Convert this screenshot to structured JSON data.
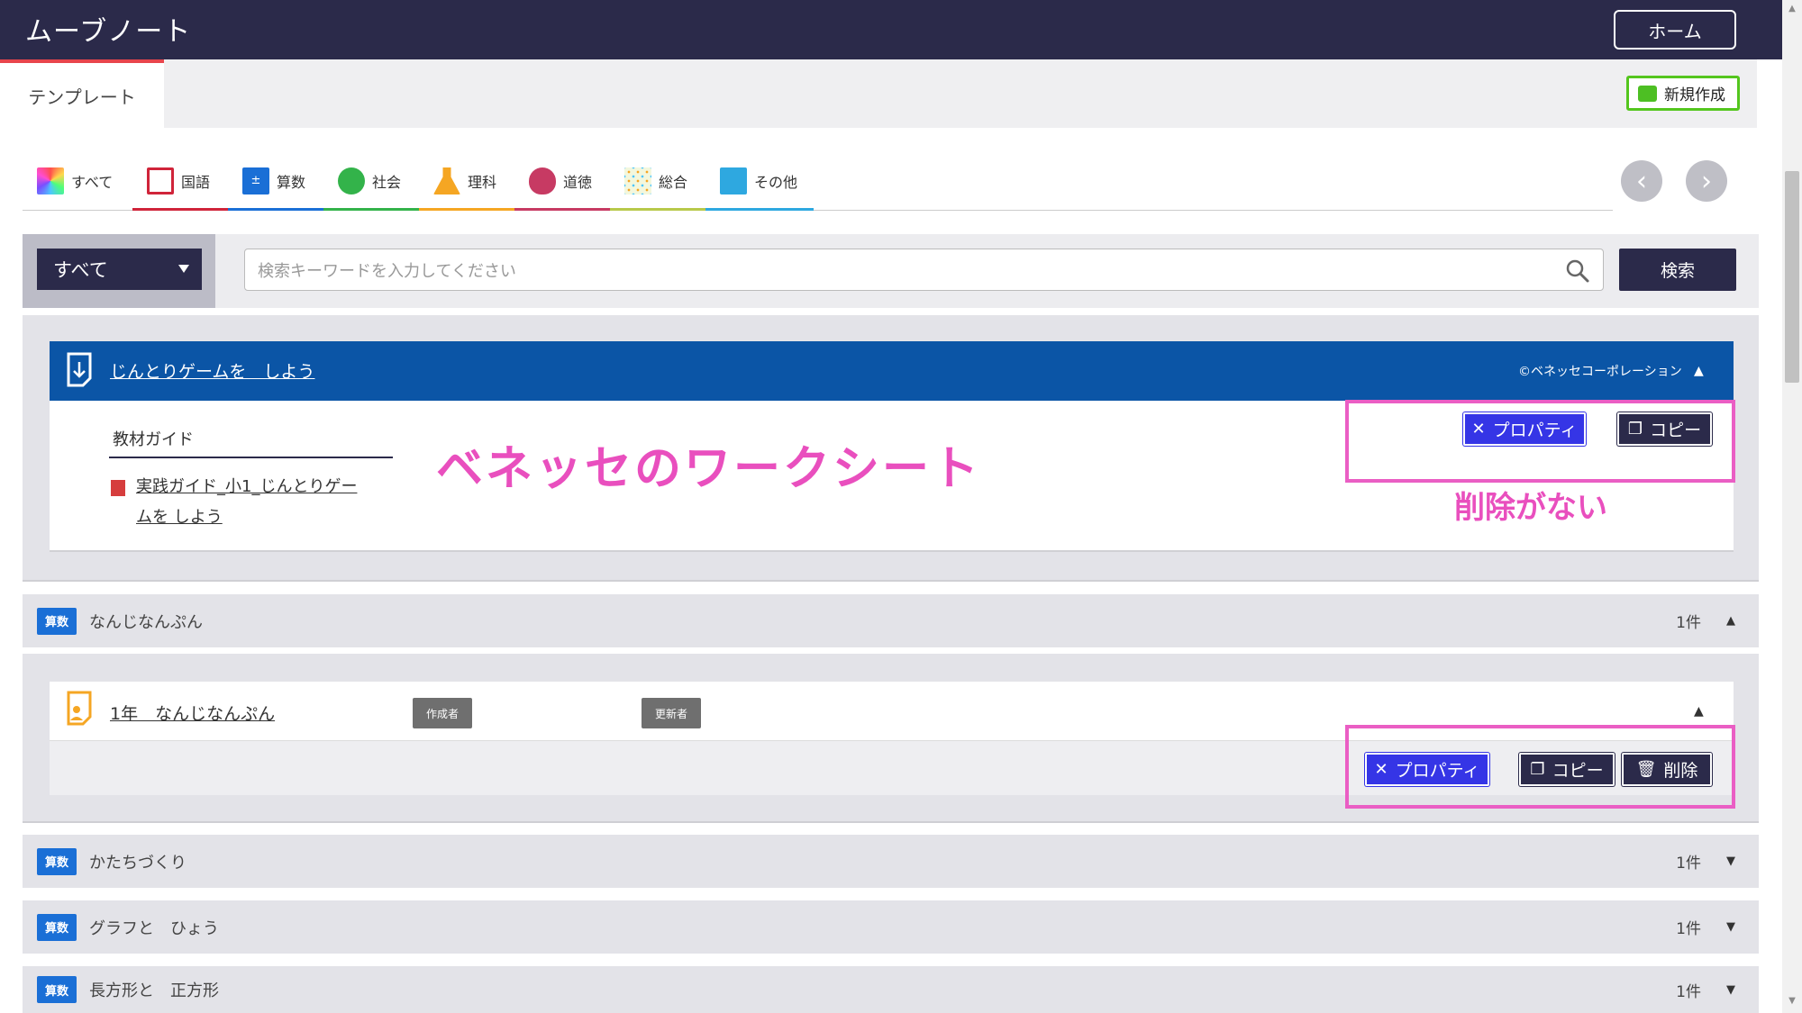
{
  "header": {
    "title": "ムーブノート",
    "home_label": "ホーム"
  },
  "tabs": {
    "active": "テンプレート",
    "new_label": "新規作成"
  },
  "categories": [
    {
      "label": "すべて",
      "icon": "rainbow-icon",
      "color": "#ff5c5c"
    },
    {
      "label": "国語",
      "icon": "kokugo-icon",
      "color": "#d0243a"
    },
    {
      "label": "算数",
      "icon": "sansu-icon",
      "color": "#1a6fd6"
    },
    {
      "label": "社会",
      "icon": "globe-icon",
      "color": "#33b34a"
    },
    {
      "label": "理科",
      "icon": "flask-icon",
      "color": "#f5a623"
    },
    {
      "label": "道徳",
      "icon": "heart-icon",
      "color": "#c73a63"
    },
    {
      "label": "総合",
      "icon": "dots-icon",
      "color": "#b8c94a"
    },
    {
      "label": "その他",
      "icon": "note-icon",
      "color": "#2ea8e0"
    }
  ],
  "search": {
    "filter_value": "すべて",
    "placeholder": "検索キーワードを入力してください",
    "button_label": "検索"
  },
  "card1": {
    "title": "じんとりゲームを　しよう",
    "copyright": "©ベネッセコーポレーション",
    "guide_label": "教材ガイド",
    "guide_link_line1": "実践ガイド_小1_じんとりゲー",
    "guide_link_line2": "ムを しよう",
    "property_label": "プロパティ",
    "copy_label": "コピー"
  },
  "annotations": {
    "title": "ベネッセのワークシート",
    "note": "削除がない",
    "color": "#e94fbe"
  },
  "group1": {
    "badge": "算数",
    "name": "なんじなんぷん",
    "count": "1件"
  },
  "card2": {
    "title": "1年　なんじなんぷん",
    "creator_label": "作成者",
    "updater_label": "更新者",
    "property_label": "プロパティ",
    "copy_label": "コピー",
    "delete_label": "削除"
  },
  "groups": [
    {
      "badge": "算数",
      "name": "かたちづくり",
      "count": "1件"
    },
    {
      "badge": "算数",
      "name": "グラフと　ひょう",
      "count": "1件"
    },
    {
      "badge": "算数",
      "name": "長方形と　正方形",
      "count": "1件"
    }
  ]
}
